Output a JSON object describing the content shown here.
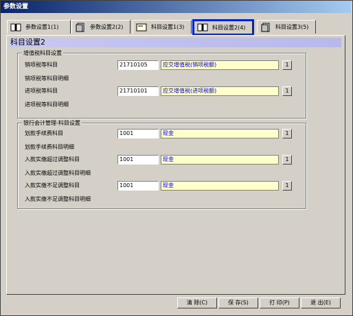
{
  "window": {
    "title": "参数设置"
  },
  "tabs": [
    {
      "label": "参数设置1(1)"
    },
    {
      "label": "参数设置2(2)"
    },
    {
      "label": "科目设置1(3)"
    },
    {
      "label": "科目设置2(4)"
    },
    {
      "label": "科目设置3(5)"
    }
  ],
  "section_title": "科目设置2",
  "vat_group": {
    "legend": "增值税科目设置",
    "sales_tax_label": "销项税等科目",
    "sales_tax_code": "21710105",
    "sales_tax_name": "应交增值税(销项税额)",
    "sales_tax_detail_label": "销项税等科目明细",
    "input_tax_label": "进项税等科目",
    "input_tax_code": "21710101",
    "input_tax_name": "应交增值税(进项税额)",
    "input_tax_detail_label": "进项税等科目明细"
  },
  "bank_group": {
    "legend": "银行会计管理-科目设置",
    "fee_label": "划款手续费科目",
    "fee_code": "1001",
    "fee_name": "现金",
    "fee_detail_label": "划款手续费科目明细",
    "over_label": "入款实缴超过调整科目",
    "over_code": "1001",
    "over_name": "现金",
    "over_detail_label": "入款实缴超过调整科目明细",
    "under_label": "入款实缴不足调整科目",
    "under_code": "1001",
    "under_name": "现金",
    "under_detail_label": "入款实缴不足调整科目明细"
  },
  "pick_label": "1",
  "buttons": {
    "clear": "清 除(C)",
    "save": "保 存(S)",
    "print": "打 印(P)",
    "exit": "退 出(E)"
  }
}
